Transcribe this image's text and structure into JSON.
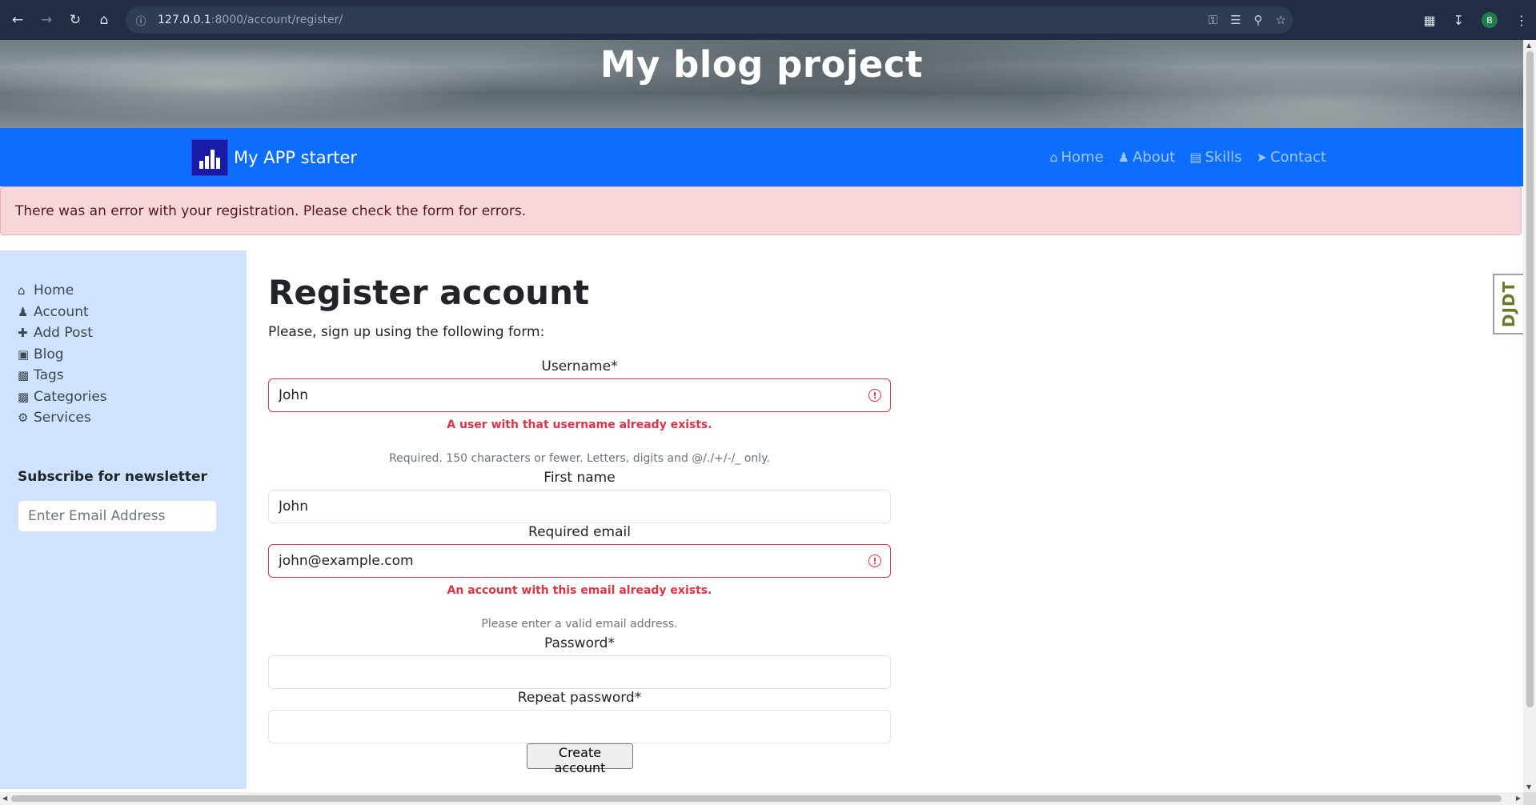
{
  "browser": {
    "url_host": "127.0.0.1",
    "url_path": ":8000/account/register/",
    "profile_initial": "B"
  },
  "hero": {
    "title": "My blog project"
  },
  "navbar": {
    "brand": "My APP starter",
    "links": [
      {
        "icon": "home-icon",
        "label": "Home"
      },
      {
        "icon": "user-icon",
        "label": "About"
      },
      {
        "icon": "book-icon",
        "label": "Skills"
      },
      {
        "icon": "paper-plane-icon",
        "label": "Contact"
      }
    ]
  },
  "alert": {
    "message": "There was an error with your registration. Please check the form for errors."
  },
  "sidebar": {
    "items": [
      {
        "icon": "home-icon",
        "label": "Home"
      },
      {
        "icon": "user-icon",
        "label": "Account"
      },
      {
        "icon": "plus-icon",
        "label": "Add Post"
      },
      {
        "icon": "sticky-note-icon",
        "label": "Blog"
      },
      {
        "icon": "briefcase-icon",
        "label": "Tags"
      },
      {
        "icon": "briefcase-icon",
        "label": "Categories"
      },
      {
        "icon": "gears-icon",
        "label": "Services"
      }
    ],
    "newsletter_title": "Subscribe for newsletter",
    "newsletter_placeholder": "Enter Email Address"
  },
  "form": {
    "title": "Register account",
    "intro": "Please, sign up using the following form:",
    "username_label": "Username*",
    "username_value": "John",
    "username_error": "A user with that username already exists.",
    "username_help": "Required. 150 characters or fewer. Letters, digits and @/./+/-/_ only.",
    "first_name_label": "First name",
    "first_name_value": "John",
    "email_label": "Required email",
    "email_value": "john@example.com",
    "email_error": "An account with this email already exists.",
    "email_help": "Please enter a valid email address.",
    "password_label": "Password*",
    "password_value": "",
    "repeat_password_label": "Repeat password*",
    "repeat_password_value": "",
    "submit_label": "Create account"
  },
  "debug_toolbar": {
    "label": "DJDT"
  },
  "colors": {
    "navbar": "#0d6efd",
    "sidebar": "#cfe2ff",
    "alert_bg": "#f8d7da",
    "error": "#dc3545"
  }
}
